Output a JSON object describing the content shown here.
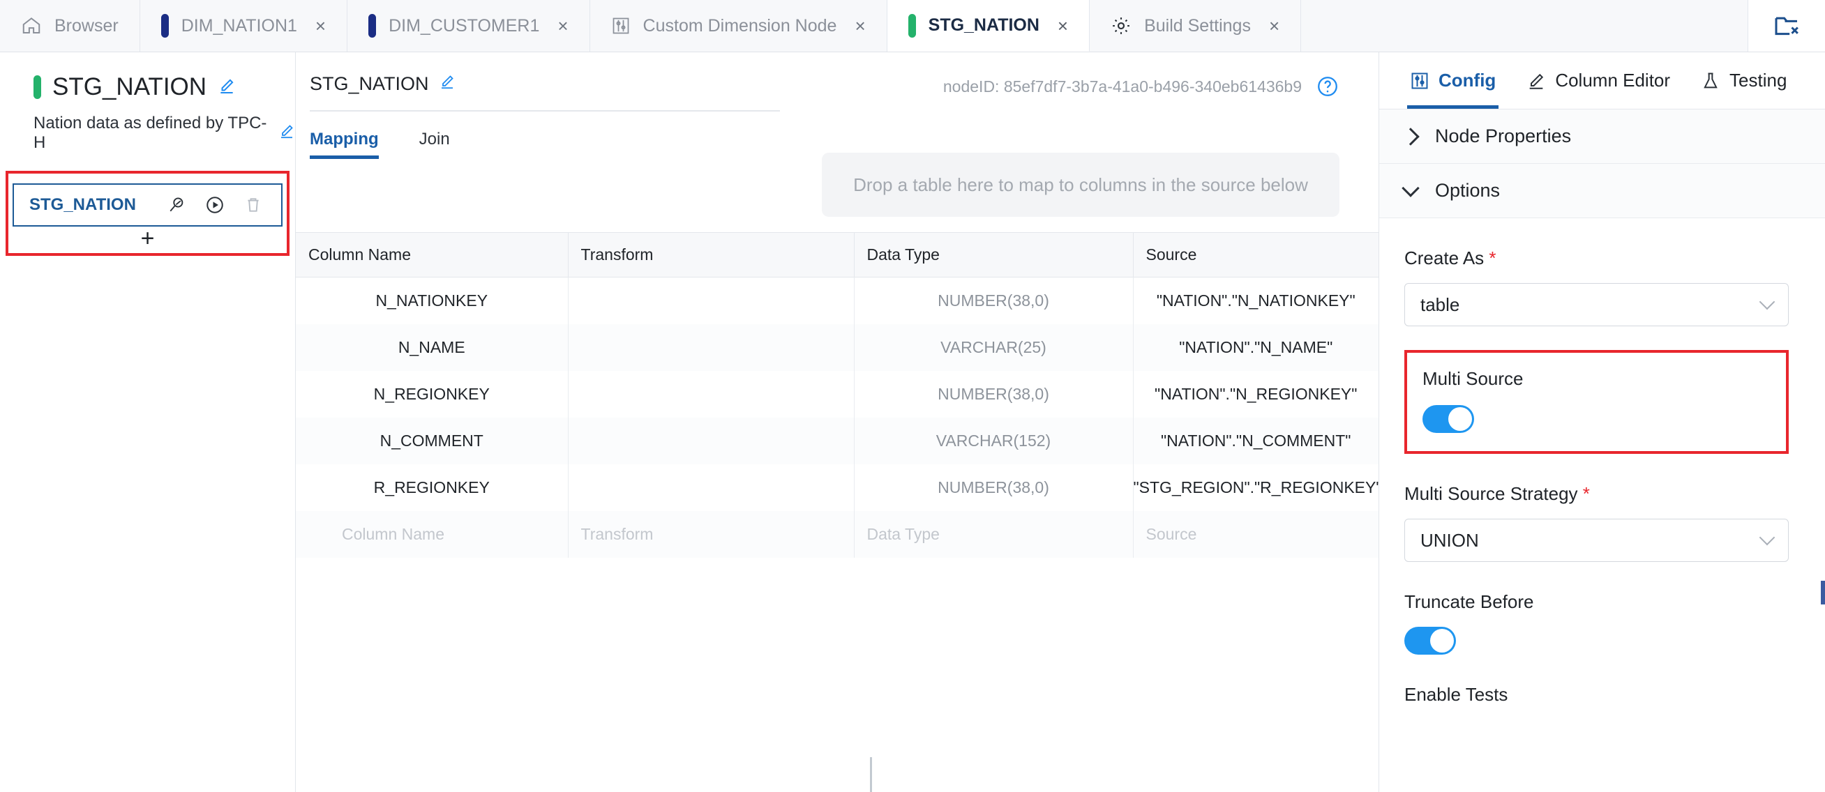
{
  "tabbar": {
    "tabs": [
      {
        "label": "Browser",
        "icon": "home-icon",
        "marker": "none",
        "closable": false,
        "active": false
      },
      {
        "label": "DIM_NATION1",
        "icon": "none",
        "marker": "blue",
        "closable": true,
        "active": false
      },
      {
        "label": "DIM_CUSTOMER1",
        "icon": "none",
        "marker": "blue",
        "closable": true,
        "active": false
      },
      {
        "label": "Custom Dimension Node",
        "icon": "sliders-icon",
        "marker": "none",
        "closable": true,
        "active": false
      },
      {
        "label": "STG_NATION",
        "icon": "none",
        "marker": "green",
        "closable": true,
        "active": true
      },
      {
        "label": "Build Settings",
        "icon": "gear-icon",
        "marker": "none",
        "closable": true,
        "active": false
      }
    ],
    "close_glyph": "×",
    "right_action": {
      "name": "close-all-tabs-icon",
      "label": ""
    }
  },
  "node_header": {
    "title": "STG_NATION",
    "marker_color": "#24b26b",
    "edit_icon": "pencil-icon",
    "description": "Nation data as defined by TPC-H",
    "description_edit_icon": "pencil-icon"
  },
  "sources_panel": {
    "highlight_color": "#e8262d",
    "item": {
      "name": "STG_NATION",
      "actions": [
        {
          "name": "preview-search-icon"
        },
        {
          "name": "run-play-icon"
        },
        {
          "name": "delete-trash-icon"
        }
      ]
    },
    "add_label": "+"
  },
  "main": {
    "nodeid_label": "nodeID: 85ef7df7-3b7a-41a0-b496-340eb61436b9",
    "help_icon": "help-circle-icon",
    "mapping_title": "STG_NATION",
    "mapping_title_edit_icon": "pencil-icon",
    "tabs": [
      {
        "label": "Mapping",
        "active": true
      },
      {
        "label": "Join",
        "active": false
      }
    ],
    "dropzone_text": "Drop a table here to map to columns in the source below",
    "table": {
      "headers": [
        "Column Name",
        "Transform",
        "Data Type",
        "Source"
      ],
      "rows": [
        {
          "column_name": "N_NATIONKEY",
          "transform": "",
          "data_type": "NUMBER(38,0)",
          "source": "\"NATION\".\"N_NATIONKEY\""
        },
        {
          "column_name": "N_NAME",
          "transform": "",
          "data_type": "VARCHAR(25)",
          "source": "\"NATION\".\"N_NAME\""
        },
        {
          "column_name": "N_REGIONKEY",
          "transform": "",
          "data_type": "NUMBER(38,0)",
          "source": "\"NATION\".\"N_REGIONKEY\""
        },
        {
          "column_name": "N_COMMENT",
          "transform": "",
          "data_type": "VARCHAR(152)",
          "source": "\"NATION\".\"N_COMMENT\""
        },
        {
          "column_name": "R_REGIONKEY",
          "transform": "",
          "data_type": "NUMBER(38,0)",
          "source": "\"STG_REGION\".\"R_REGIONKEY\""
        }
      ],
      "placeholder_row": {
        "column_name": "Column Name",
        "transform": "Transform",
        "data_type": "Data Type",
        "source": "Source"
      }
    }
  },
  "right_panel": {
    "tabs": [
      {
        "label": "Config",
        "icon": "sliders-icon",
        "active": true
      },
      {
        "label": "Column Editor",
        "icon": "pencil-icon",
        "active": false
      },
      {
        "label": "Testing",
        "icon": "flask-icon",
        "active": false
      }
    ],
    "sections": [
      {
        "label": "Node Properties",
        "expanded": false
      },
      {
        "label": "Options",
        "expanded": true
      }
    ],
    "options": {
      "create_as": {
        "label": "Create As",
        "required": true,
        "value": "table"
      },
      "multi_source": {
        "label": "Multi Source",
        "value": "on",
        "highlight_color": "#e8262d"
      },
      "multi_source_strategy": {
        "label": "Multi Source Strategy",
        "required": true,
        "value": "UNION"
      },
      "truncate_before": {
        "label": "Truncate Before",
        "value": "on"
      },
      "enable_tests": {
        "label": "Enable Tests"
      }
    },
    "required_marker": "*",
    "toggle_on_color": "#1e96f0"
  }
}
